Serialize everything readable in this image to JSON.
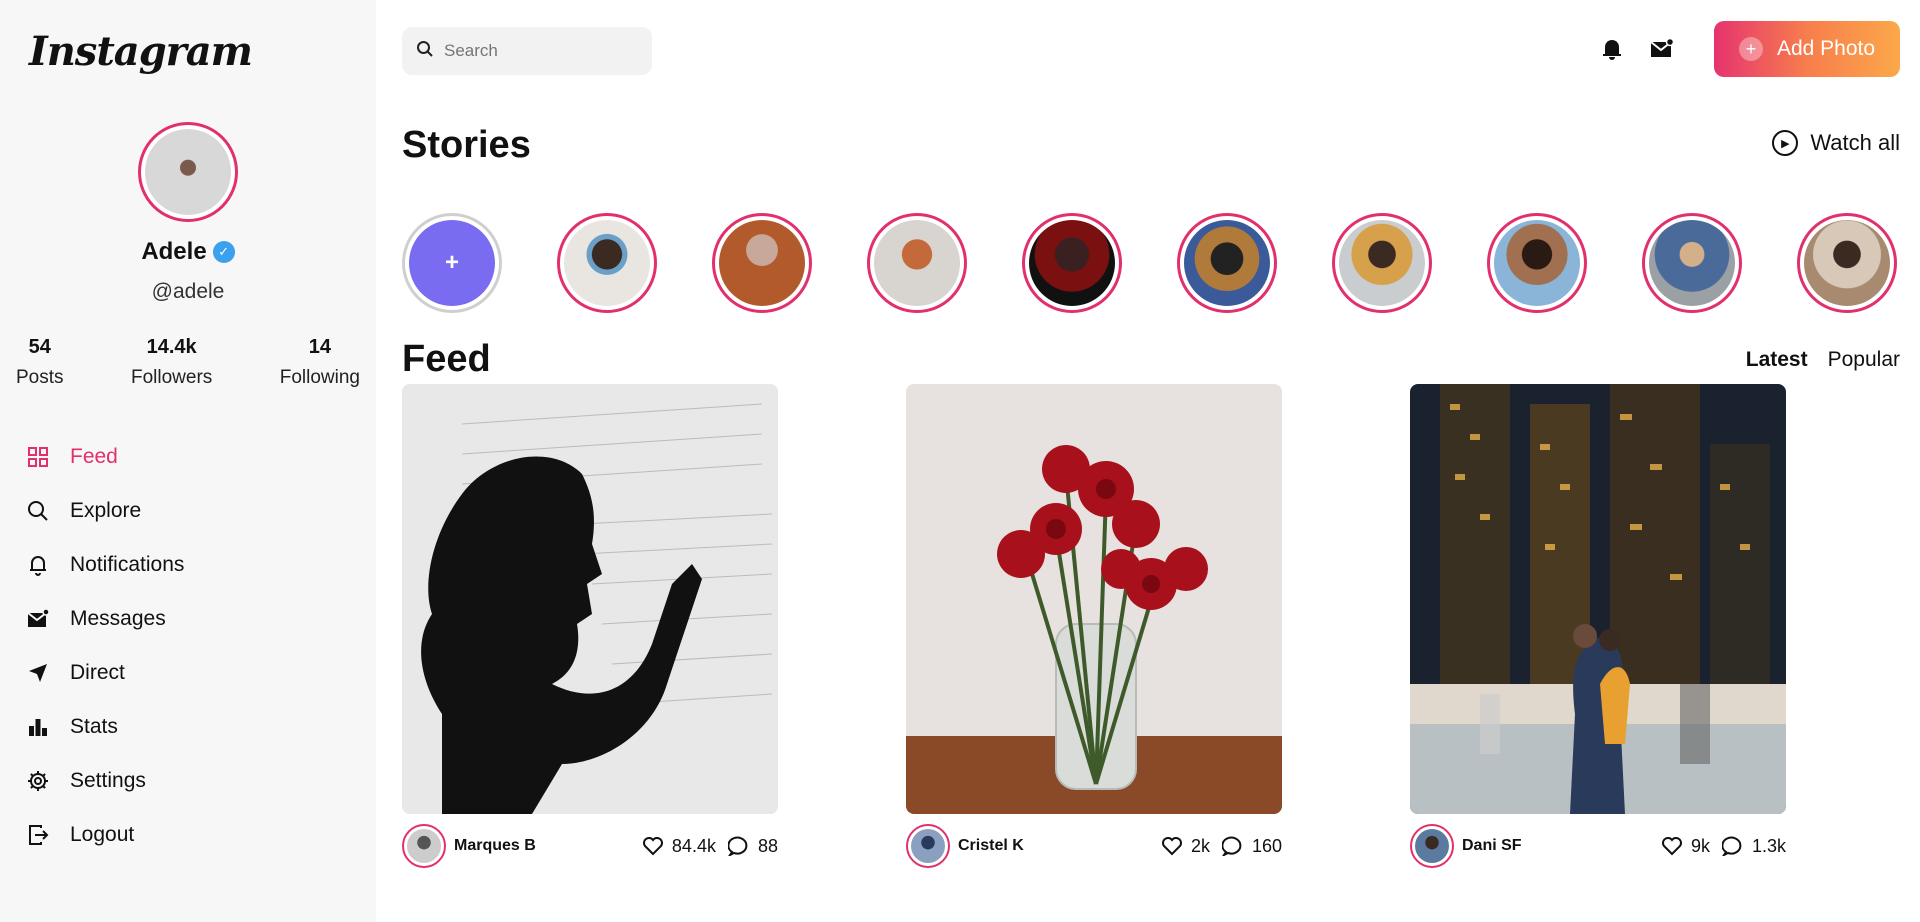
{
  "brand": {
    "logo_text": "Instagram"
  },
  "profile": {
    "name": "Adele",
    "handle": "@adele",
    "stats": [
      {
        "value": "54",
        "label": "Posts"
      },
      {
        "value": "14.4k",
        "label": "Followers"
      },
      {
        "value": "14",
        "label": "Following"
      }
    ]
  },
  "nav": {
    "items": [
      {
        "label": "Feed",
        "icon": "grid-icon",
        "active": true
      },
      {
        "label": "Explore",
        "icon": "search-icon"
      },
      {
        "label": "Notifications",
        "icon": "bell-icon"
      },
      {
        "label": "Messages",
        "icon": "mail-icon"
      },
      {
        "label": "Direct",
        "icon": "send-icon"
      },
      {
        "label": "Stats",
        "icon": "bar-chart-icon"
      },
      {
        "label": "Settings",
        "icon": "gear-icon"
      },
      {
        "label": "Logout",
        "icon": "logout-icon"
      }
    ]
  },
  "header": {
    "search_placeholder": "Search",
    "add_photo_label": "Add Photo"
  },
  "stories": {
    "title": "Stories",
    "watch_all_label": "Watch all",
    "add_symbol": "+"
  },
  "feed": {
    "title": "Feed",
    "tabs": [
      {
        "label": "Latest",
        "active": true
      },
      {
        "label": "Popular"
      }
    ],
    "posts": [
      {
        "author": "Marques B",
        "likes": "84.4k",
        "comments": "88"
      },
      {
        "author": "Cristel K",
        "likes": "2k",
        "comments": "160"
      },
      {
        "author": "Dani SF",
        "likes": "9k",
        "comments": "1.3k"
      }
    ]
  },
  "colors": {
    "accent": "#e1306c",
    "add_story": "#7a6cf0",
    "verified": "#3ba0ee"
  }
}
